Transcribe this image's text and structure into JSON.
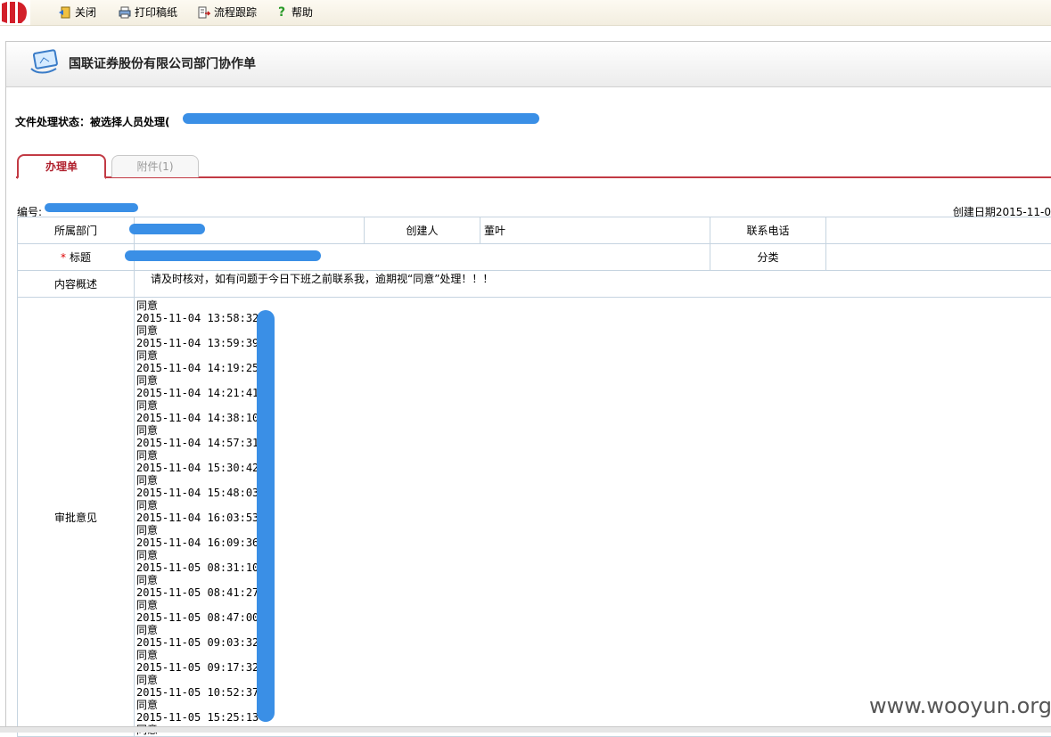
{
  "toolbar": {
    "close_label": "关闭",
    "print_label": "打印稿纸",
    "trace_label": "流程跟踪",
    "help_label": "帮助"
  },
  "header": {
    "title": "国联证券股份有限公司部门协作单"
  },
  "status": {
    "label": "文件处理状态：被选择人员处理("
  },
  "tabs": [
    {
      "label": "办理单"
    },
    {
      "label": "附件(1)"
    }
  ],
  "meta": {
    "serial_label": "编号:",
    "created_label": "创建日期2015-11-0"
  },
  "form": {
    "dept_label": "所属部门",
    "creator_label": "创建人",
    "creator_value": "董叶",
    "phone_label": "联系电话",
    "title_label": "标题",
    "category_label": "分类",
    "summary_label": "内容概述",
    "summary_value": "请及时核对，如有问题于今日下班之前联系我，逾期视“同意”处理！！！",
    "approval_label": "审批意见"
  },
  "approvals": [
    {
      "opinion": "同意",
      "time": "2015-11-04 13:58:32"
    },
    {
      "opinion": "同意",
      "time": "2015-11-04 13:59:39"
    },
    {
      "opinion": "同意",
      "time": "2015-11-04 14:19:25"
    },
    {
      "opinion": "同意",
      "time": "2015-11-04 14:21:41"
    },
    {
      "opinion": "同意",
      "time": "2015-11-04 14:38:10"
    },
    {
      "opinion": "同意",
      "time": "2015-11-04 14:57:31"
    },
    {
      "opinion": "同意",
      "time": "2015-11-04 15:30:42"
    },
    {
      "opinion": "同意",
      "time": "2015-11-04 15:48:03"
    },
    {
      "opinion": "同意",
      "time": "2015-11-04 16:03:53"
    },
    {
      "opinion": "同意",
      "time": "2015-11-04 16:09:36"
    },
    {
      "opinion": "同意",
      "time": "2015-11-05 08:31:10"
    },
    {
      "opinion": "同意",
      "time": "2015-11-05 08:41:27"
    },
    {
      "opinion": "同意",
      "time": "2015-11-05 08:47:00"
    },
    {
      "opinion": "同意",
      "time": "2015-11-05 09:03:32"
    },
    {
      "opinion": "同意",
      "time": "2015-11-05 09:17:32"
    },
    {
      "opinion": "同意",
      "time": "2015-11-05 10:52:37"
    },
    {
      "opinion": "同意",
      "time": "2015-11-05 15:25:13"
    },
    {
      "opinion": "同意",
      "time": ""
    }
  ],
  "watermark": "www.wooyun.org",
  "colors": {
    "accent": "#c23a44",
    "redaction": "#3a8fe6",
    "table_border": "#c6d4e0"
  }
}
